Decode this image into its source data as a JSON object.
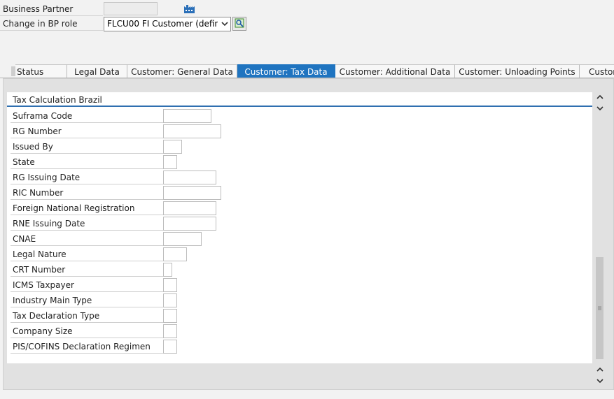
{
  "header": {
    "business_partner_label": "Business Partner",
    "business_partner_value": "",
    "bp_role_label": "Change in BP role",
    "bp_role_value": "FLCU00 FI Customer (define..."
  },
  "tabs": [
    {
      "label": "Status",
      "active": false
    },
    {
      "label": "Legal Data",
      "active": false
    },
    {
      "label": "Customer: General Data",
      "active": false
    },
    {
      "label": "Customer: Tax Data",
      "active": true
    },
    {
      "label": "Customer: Additional Data",
      "active": false
    },
    {
      "label": "Customer: Unloading Points",
      "active": false
    },
    {
      "label": "Custon",
      "active": false
    }
  ],
  "group": {
    "title": "Tax Calculation Brazil",
    "fields": [
      {
        "label": "Suframa Code",
        "value": ""
      },
      {
        "label": "RG Number",
        "value": ""
      },
      {
        "label": "Issued By",
        "value": ""
      },
      {
        "label": "State",
        "value": ""
      },
      {
        "label": "RG Issuing Date",
        "value": ""
      },
      {
        "label": "RIC Number",
        "value": ""
      },
      {
        "label": "Foreign National Registration",
        "value": ""
      },
      {
        "label": "RNE Issuing Date",
        "value": ""
      },
      {
        "label": "CNAE",
        "value": ""
      },
      {
        "label": "Legal Nature",
        "value": ""
      },
      {
        "label": "CRT Number",
        "value": ""
      },
      {
        "label": "ICMS Taxpayer",
        "value": ""
      },
      {
        "label": "Industry Main Type",
        "value": ""
      },
      {
        "label": "Tax Declaration Type",
        "value": ""
      },
      {
        "label": "Company Size",
        "value": ""
      },
      {
        "label": "PIS/COFINS Declaration Regimen",
        "value": ""
      }
    ]
  },
  "colors": {
    "active_tab": "#1f74c0",
    "group_underline": "#2f6fb0"
  },
  "icons": {
    "factory": "factory-icon",
    "execute": "execute-icon",
    "dropdown": "chevron-down-icon"
  }
}
